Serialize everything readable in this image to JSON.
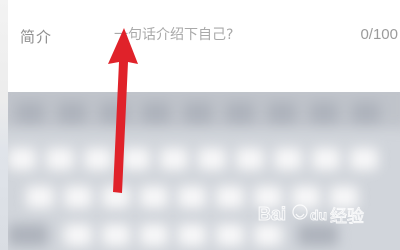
{
  "bio": {
    "label": "简介",
    "placeholder": "一句话介绍下自己?",
    "value": "",
    "counter": "0/100"
  },
  "annotation": {
    "arrow_color": "#e0222a"
  },
  "watermark": {
    "text": "Baidu经验"
  }
}
